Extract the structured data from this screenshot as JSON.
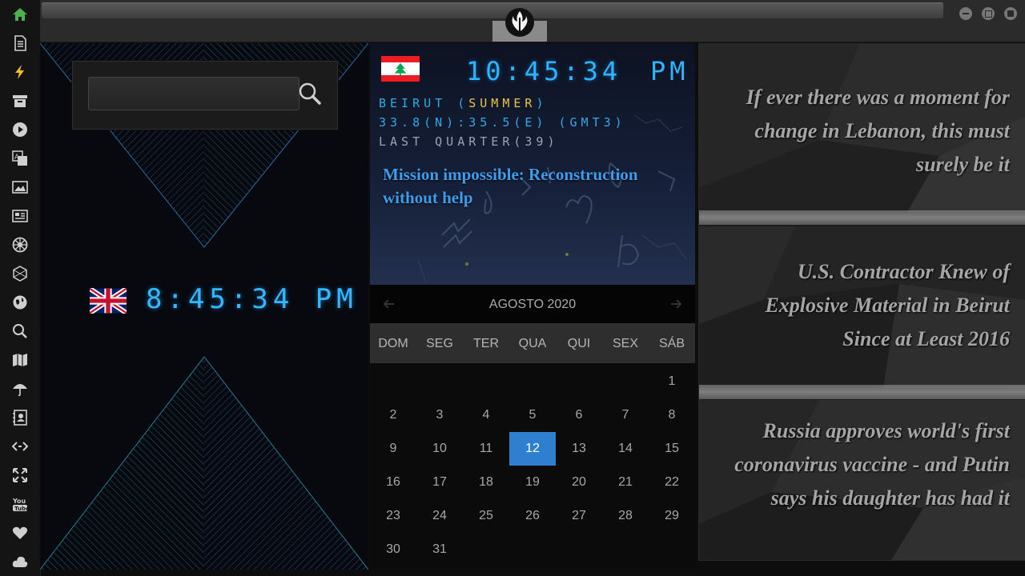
{
  "sidebar": {
    "icons": [
      "home-icon",
      "document-icon",
      "lightning-icon",
      "archive-icon",
      "play-icon",
      "translate-icon",
      "image-icon",
      "newspaper-icon",
      "empire-icon",
      "hexagon-icon",
      "globe-icon",
      "search-icon",
      "map-icon",
      "umbrella-icon",
      "contacts-icon",
      "code-icon",
      "expand-icon",
      "youtube-icon",
      "heart-icon",
      "cloud-icon"
    ]
  },
  "left": {
    "search_placeholder": "",
    "uk_time": "8:45:34  PM"
  },
  "lebanon": {
    "time": "10:45:34",
    "ampm": "PM",
    "city_prefix": "BEIRUT (",
    "season": "SUMMER",
    "city_suffix": ")",
    "coords": "33.8(N):35.5(E) (GMT3)",
    "moon": "LAST QUARTER(39)",
    "headline": "Mission impossible: Reconstruction without help"
  },
  "calendar": {
    "month": "AGOSTO 2020",
    "daynames": [
      "DOM",
      "SEG",
      "TER",
      "QUA",
      "QUI",
      "SEX",
      "SÁB"
    ],
    "weeks": [
      [
        "",
        "",
        "",
        "",
        "",
        "",
        "1"
      ],
      [
        "2",
        "3",
        "4",
        "5",
        "6",
        "7",
        "8"
      ],
      [
        "9",
        "10",
        "11",
        "12",
        "13",
        "14",
        "15"
      ],
      [
        "16",
        "17",
        "18",
        "19",
        "20",
        "21",
        "22"
      ],
      [
        "23",
        "24",
        "25",
        "26",
        "27",
        "28",
        "29"
      ],
      [
        "30",
        "31",
        "",
        "",
        "",
        "",
        ""
      ]
    ],
    "today": "12"
  },
  "news": {
    "items": [
      "If ever there was a moment for change in Lebanon, this must surely be it",
      "U.S. Contractor Knew of Explosive Material in Beirut Since at Least 2016",
      "Russia approves world's first coronavirus vaccine - and Putin says his daughter has had it"
    ]
  },
  "colors": {
    "accent": "#2fb4ff",
    "season": "#e8c44a",
    "today": "#2f7fd0",
    "home_icon": "#4caf50",
    "lightning_icon": "#f0c020"
  }
}
